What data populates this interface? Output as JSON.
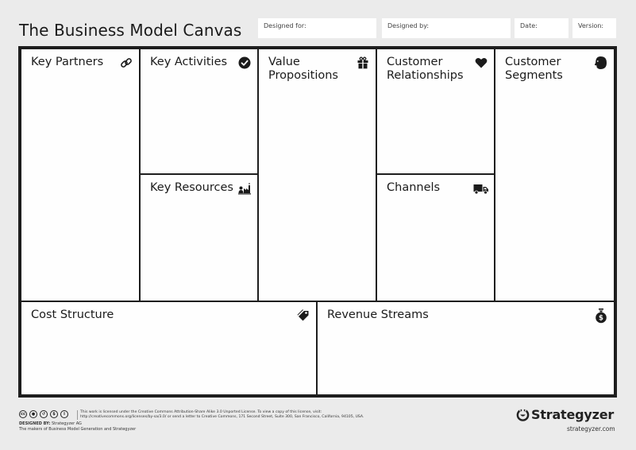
{
  "header": {
    "title": "The Business Model Canvas",
    "fields": [
      {
        "label": "Designed for:",
        "value": ""
      },
      {
        "label": "Designed by:",
        "value": ""
      },
      {
        "label": "Date:",
        "value": ""
      },
      {
        "label": "Version:",
        "value": ""
      }
    ]
  },
  "blocks": {
    "key_partners": {
      "label": "Key Partners",
      "icon": "link-icon"
    },
    "key_activities": {
      "label": "Key Activities",
      "icon": "checkmark-circle-icon"
    },
    "key_resources": {
      "label": "Key Resources",
      "icon": "worker-factory-icon"
    },
    "value_propositions": {
      "label": "Value Propositions",
      "icon": "gift-icon"
    },
    "customer_relationships": {
      "label": "Customer Relationships",
      "icon": "heart-icon"
    },
    "channels": {
      "label": "Channels",
      "icon": "truck-icon"
    },
    "customer_segments": {
      "label": "Customer Segments",
      "icon": "head-icon"
    },
    "cost_structure": {
      "label": "Cost Structure",
      "icon": "price-tag-icon"
    },
    "revenue_streams": {
      "label": "Revenue Streams",
      "icon": "money-bag-icon"
    }
  },
  "footer": {
    "cc_icons": [
      "cc",
      "by",
      "sa",
      "nc",
      "info"
    ],
    "license_line1": "This work is licensed under the Creative Commons Attribution-Share Alike 3.0 Unported License. To view a copy of this license, visit:",
    "license_line2": "http://creativecommons.org/licenses/by-sa/3.0/ or send a letter to Creative Commons, 171 Second Street, Suite 300, San Francisco, California, 94105, USA.",
    "designed_by_label": "DESIGNED BY:",
    "designed_by_value": "Strategyzer AG",
    "makers": "The makers of Business Model Generation and Strategyzer",
    "brand": "Strategyzer",
    "brand_url": "strategyzer.com"
  }
}
